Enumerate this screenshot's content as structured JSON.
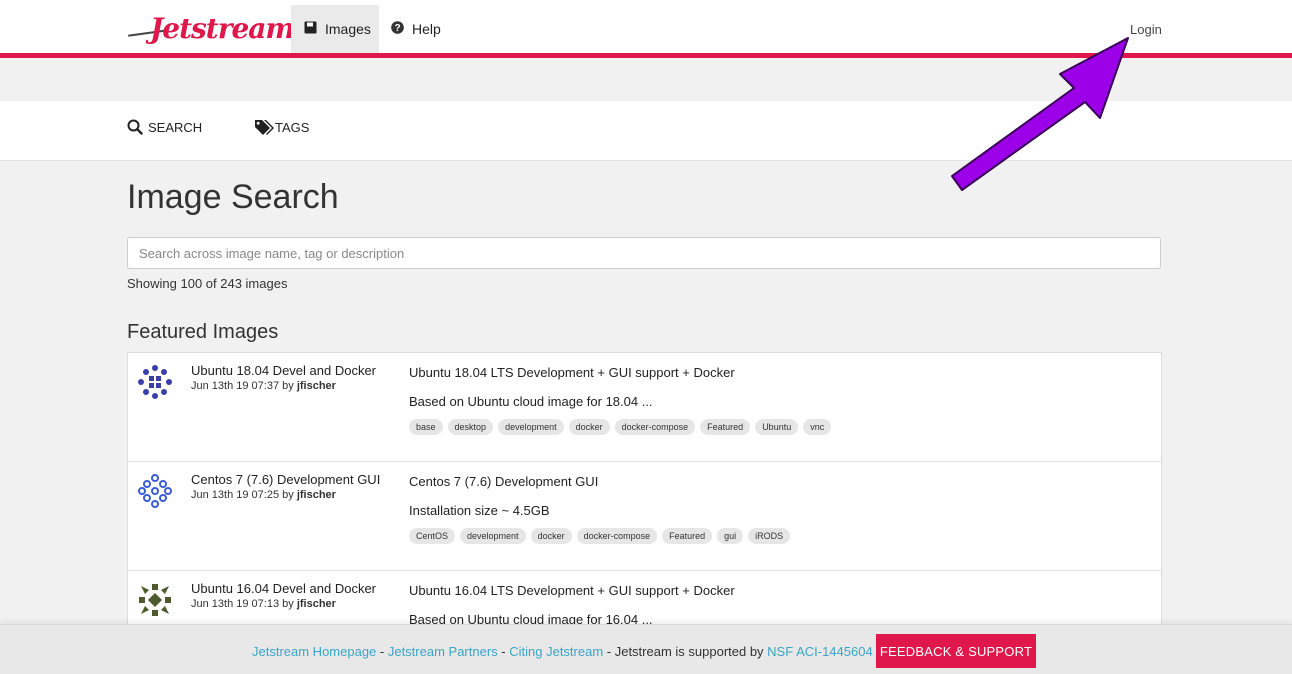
{
  "nav": {
    "logo_text": "Jetstream",
    "images_label": "Images",
    "help_label": "Help",
    "login_label": "Login"
  },
  "subnav": {
    "search_label": "SEARCH",
    "tags_label": "TAGS"
  },
  "main": {
    "title": "Image Search",
    "search_placeholder": "Search across image name, tag or description",
    "count_text": "Showing 100 of 243 images",
    "featured_title": "Featured Images"
  },
  "images": [
    {
      "name": "Ubuntu 18.04 Devel and Docker",
      "date": "Jun 13th 19 07:37 by ",
      "author": "jfischer",
      "title": "Ubuntu 18.04 LTS Development + GUI support + Docker",
      "desc": "Based on Ubuntu cloud image for 18.04 ...",
      "tags": [
        "base",
        "desktop",
        "development",
        "docker",
        "docker-compose",
        "Featured",
        "Ubuntu",
        "vnc"
      ]
    },
    {
      "name": "Centos 7 (7.6) Development GUI",
      "date": "Jun 13th 19 07:25 by ",
      "author": "jfischer",
      "title": "Centos 7 (7.6) Development GUI",
      "desc": "Installation size ~ 4.5GB",
      "tags": [
        "CentOS",
        "development",
        "docker",
        "docker-compose",
        "Featured",
        "gui",
        "iRODS"
      ]
    },
    {
      "name": "Ubuntu 16.04 Devel and Docker",
      "date": "Jun 13th 19 07:13 by ",
      "author": "jfischer",
      "title": "Ubuntu 16.04 LTS Development + GUI support + Docker",
      "desc": "Based on Ubuntu cloud image for 16.04 ...",
      "tags": []
    }
  ],
  "footer": {
    "link_homepage": "Jetstream Homepage",
    "sep1": " - ",
    "link_partners": "Jetstream Partners",
    "sep2": " - ",
    "link_citing": "Citing Jetstream",
    "supported_text": " - Jetstream is supported by ",
    "link_nsf": "NSF ACI-1445604",
    "feedback_label": "FEEDBACK & SUPPORT"
  },
  "colors": {
    "accent": "#e0174a",
    "link": "#3aa5c6",
    "annotation_arrow": "#9b00e8"
  }
}
